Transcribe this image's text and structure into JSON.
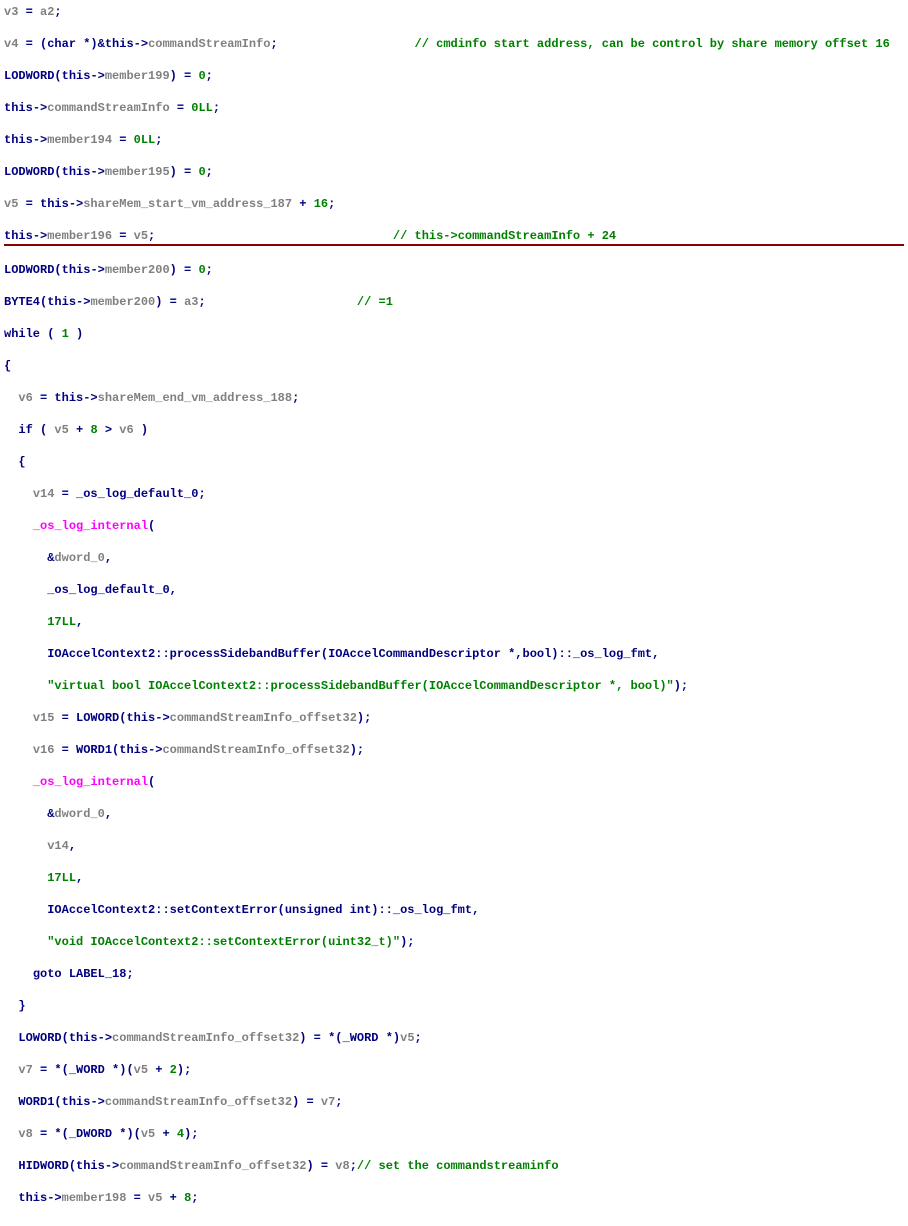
{
  "code": {
    "l1": {
      "v": "v3",
      "op1": " = ",
      "a": "a2",
      "end": ";"
    },
    "l2": {
      "v": "v4",
      "op1": " = (",
      "t": "char",
      "op2": " *)&",
      "th": "this",
      "arrow": "->",
      "m": "commandStreamInfo",
      "end": ";",
      "cmt": "// cmdinfo start address, can be control by share memory offset 16"
    },
    "l3": {
      "fn": "LODWORD",
      "op1": "(",
      "th": "this",
      "arrow": "->",
      "m": "member199",
      "op2": ") = ",
      "n": "0",
      "end": ";"
    },
    "l4": {
      "th": "this",
      "arrow": "->",
      "m": "commandStreamInfo",
      "op": " = ",
      "n": "0LL",
      "end": ";"
    },
    "l5": {
      "th": "this",
      "arrow": "->",
      "m": "member194",
      "op": " = ",
      "n": "0LL",
      "end": ";"
    },
    "l6": {
      "fn": "LODWORD",
      "op1": "(",
      "th": "this",
      "arrow": "->",
      "m": "member195",
      "op2": ") = ",
      "n": "0",
      "end": ";"
    },
    "l7": {
      "v": "v5",
      "op1": " = ",
      "th": "this",
      "arrow": "->",
      "m": "shareMem_start_vm_address_187",
      "op2": " + ",
      "n": "16",
      "end": ";"
    },
    "l8": {
      "th": "this",
      "arrow": "->",
      "m": "member196",
      "op": " = ",
      "v": "v5",
      "end": ";",
      "cmt": "// this->commandStreamInfo + 24"
    },
    "l9": {
      "fn": "LODWORD",
      "op1": "(",
      "th": "this",
      "arrow": "->",
      "m": "member200",
      "op2": ") = ",
      "n": "0",
      "end": ";"
    },
    "l10": {
      "fn": "BYTE4",
      "op1": "(",
      "th": "this",
      "arrow": "->",
      "m": "member200",
      "op2": ") = ",
      "a": "a3",
      "end": ";",
      "cmt": "// =1"
    },
    "l11": {
      "kw": "while",
      "op1": " ( ",
      "n": "1",
      "op2": " )"
    },
    "l12": {
      "b": "{"
    },
    "l13": {
      "v": "v6",
      "op1": " = ",
      "th": "this",
      "arrow": "->",
      "m": "shareMem_end_vm_address_188",
      "end": ";"
    },
    "l14": {
      "kw": "if",
      "op1": " ( ",
      "v1": "v5",
      "op2": " + ",
      "n": "8",
      "op3": " > ",
      "v2": "v6",
      "op4": " )"
    },
    "l15": {
      "b": "{"
    },
    "l16": {
      "v": "v14",
      "op1": " = ",
      "fn": "_os_log_default_0",
      "end": ";"
    },
    "l17": {
      "fn": "_os_log_internal",
      "op": "("
    },
    "l18": {
      "op": "&",
      "v": "dword_0",
      "end": ","
    },
    "l19": {
      "v": "_os_log_default_0",
      "end": ","
    },
    "l20": {
      "n": "17LL",
      "end": ","
    },
    "l21": {
      "s": "IOAccelContext2::processSidebandBuffer(IOAccelCommandDescriptor *,bool)::_os_log_fmt",
      "end": ","
    },
    "l22": {
      "s": "\"virtual bool IOAccelContext2::processSidebandBuffer(IOAccelCommandDescriptor *, bool)\"",
      "end": ");"
    },
    "l23": {
      "v": "v15",
      "op1": " = ",
      "fn": "LOWORD",
      "op2": "(",
      "th": "this",
      "arrow": "->",
      "m": "commandStreamInfo_offset32",
      "end": ");"
    },
    "l24": {
      "v": "v16",
      "op1": " = ",
      "fn": "WORD1",
      "op2": "(",
      "th": "this",
      "arrow": "->",
      "m": "commandStreamInfo_offset32",
      "end": ");"
    },
    "l25": {
      "fn": "_os_log_internal",
      "op": "("
    },
    "l26": {
      "op": "&",
      "v": "dword_0",
      "end": ","
    },
    "l27": {
      "v": "v14",
      "end": ","
    },
    "l28": {
      "n": "17LL",
      "end": ","
    },
    "l29": {
      "s": "IOAccelContext2::setContextError(unsigned int)::_os_log_fmt",
      "end": ","
    },
    "l30": {
      "s": "\"void IOAccelContext2::setContextError(uint32_t)\"",
      "end": ");"
    },
    "l31": {
      "kw": "goto",
      "lbl": " LABEL_18",
      "end": ";"
    },
    "l32": {
      "b": "}"
    },
    "l33": {
      "fn": "LOWORD",
      "op1": "(",
      "th": "this",
      "arrow": "->",
      "m": "commandStreamInfo_offset32",
      "op2": ") = *(",
      "t": "_WORD",
      "op3": " *)",
      "v": "v5",
      "end": ";"
    },
    "l34": {
      "v1": "v7",
      "op1": " = *(",
      "t": "_WORD",
      "op2": " *)(",
      "v2": "v5",
      "op3": " + ",
      "n": "2",
      "end": ");"
    },
    "l35": {
      "fn": "WORD1",
      "op1": "(",
      "th": "this",
      "arrow": "->",
      "m": "commandStreamInfo_offset32",
      "op2": ") = ",
      "v": "v7",
      "end": ";"
    },
    "l36": {
      "v1": "v8",
      "op1": " = *(",
      "t": "_DWORD",
      "op2": " *)(",
      "v2": "v5",
      "op3": " + ",
      "n": "4",
      "end": ");"
    },
    "l37": {
      "fn": "HIDWORD",
      "op1": "(",
      "th": "this",
      "arrow": "->",
      "m": "commandStreamInfo_offset32",
      "op2": ") = ",
      "v": "v8",
      "end": ";",
      "cmt": "// set the commandstreaminfo"
    },
    "l38": {
      "th": "this",
      "arrow": "->",
      "m": "member198",
      "op1": " = ",
      "v": "v5",
      "op2": " + ",
      "n": "8",
      "end": ";"
    }
  }
}
